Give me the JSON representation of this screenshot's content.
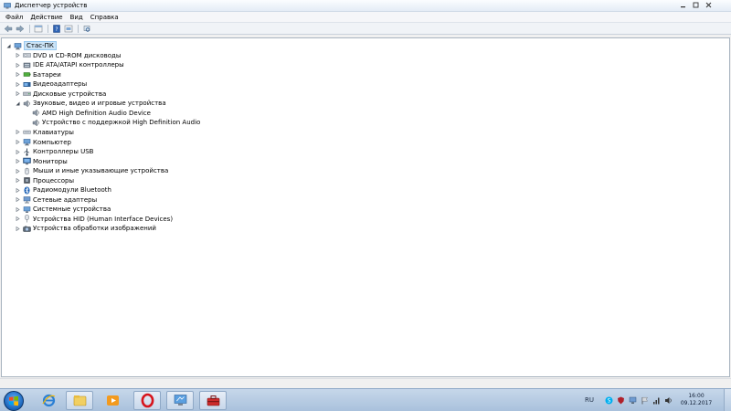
{
  "window": {
    "title": "Диспетчер устройств"
  },
  "menu": [
    {
      "label": "Файл"
    },
    {
      "label": "Действие"
    },
    {
      "label": "Вид"
    },
    {
      "label": "Справка"
    }
  ],
  "toolbar": {
    "buttons": [
      "back-arrow-icon",
      "forward-arrow-icon",
      "properties-icon",
      "help-icon",
      "devices-view-icon",
      "scan-hardware-icon"
    ]
  },
  "tree": {
    "root": {
      "label": "Стас-ПК",
      "icon": "computer-icon"
    },
    "items": [
      {
        "label": "DVD и CD-ROM дисководы",
        "icon": "dvd-drive-icon",
        "expanded": false
      },
      {
        "label": "IDE ATA/ATAPI контроллеры",
        "icon": "ide-controller-icon",
        "expanded": false
      },
      {
        "label": "Батареи",
        "icon": "battery-icon",
        "expanded": false
      },
      {
        "label": "Видеоадаптеры",
        "icon": "display-adapter-icon",
        "expanded": false
      },
      {
        "label": "Дисковые устройства",
        "icon": "disk-drive-icon",
        "expanded": false
      },
      {
        "label": "Звуковые, видео и игровые устройства",
        "icon": "speaker-icon",
        "expanded": true,
        "children": [
          {
            "label": "AMD High Definition Audio Device",
            "icon": "speaker-icon"
          },
          {
            "label": "Устройство с поддержкой High Definition Audio",
            "icon": "speaker-icon"
          }
        ]
      },
      {
        "label": "Клавиатуры",
        "icon": "keyboard-icon",
        "expanded": false
      },
      {
        "label": "Компьютер",
        "icon": "computer-icon",
        "expanded": false
      },
      {
        "label": "Контроллеры USB",
        "icon": "usb-icon",
        "expanded": false
      },
      {
        "label": "Мониторы",
        "icon": "monitor-icon",
        "expanded": false
      },
      {
        "label": "Мыши и иные указывающие устройства",
        "icon": "mouse-icon",
        "expanded": false
      },
      {
        "label": "Процессоры",
        "icon": "processor-icon",
        "expanded": false
      },
      {
        "label": "Радиомодули Bluetooth",
        "icon": "bluetooth-icon",
        "expanded": false
      },
      {
        "label": "Сетевые адаптеры",
        "icon": "network-adapter-icon",
        "expanded": false
      },
      {
        "label": "Системные устройства",
        "icon": "system-devices-icon",
        "expanded": false
      },
      {
        "label": "Устройства HID (Human Interface Devices)",
        "icon": "hid-icon",
        "expanded": false
      },
      {
        "label": "Устройства обработки изображений",
        "icon": "imaging-device-icon",
        "expanded": false
      }
    ]
  },
  "taskbar": {
    "apps": [
      {
        "name": "internet-explorer-icon",
        "open": false
      },
      {
        "name": "file-explorer-icon",
        "open": true
      },
      {
        "name": "media-player-icon",
        "open": false
      },
      {
        "name": "opera-icon",
        "open": true
      },
      {
        "name": "remote-desktop-icon",
        "open": true
      },
      {
        "name": "toolbox-icon",
        "open": true
      }
    ],
    "tray": {
      "language": "RU",
      "icons": [
        "skype-icon",
        "shield-icon",
        "network-status-icon",
        "flag-icon",
        "signal-icon",
        "volume-icon"
      ]
    },
    "clock": {
      "time": "16:00",
      "date": "09.12.2017"
    }
  },
  "colors": {
    "selection": "#cce4f7",
    "taskbar": "#b8cde4"
  }
}
